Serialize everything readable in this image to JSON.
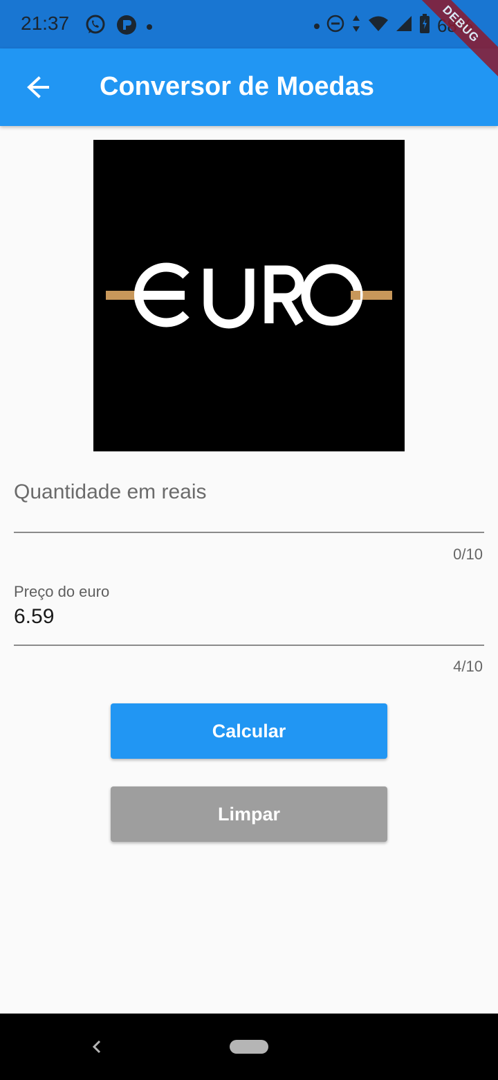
{
  "status_bar": {
    "time": "21:37",
    "battery_text": "68%",
    "left_icons": [
      "whatsapp-icon",
      "app-notification-icon",
      "dot"
    ],
    "right_icons": [
      "dot",
      "do-not-disturb-icon",
      "data-arrows-icon",
      "wifi-icon",
      "signal-icon",
      "battery-icon"
    ]
  },
  "debug_banner": "DEBUG",
  "app_bar": {
    "title": "Conversor de Moedas",
    "background": "#2196f3"
  },
  "logo": {
    "text": "€URO",
    "bar_color": "#c8975a"
  },
  "fields": {
    "amount": {
      "placeholder": "Quantidade em reais",
      "value": "",
      "counter": "0/10"
    },
    "price": {
      "label": "Preço do euro",
      "value": "6.59",
      "counter": "4/10"
    }
  },
  "buttons": {
    "calculate": "Calcular",
    "clear": "Limpar"
  },
  "colors": {
    "primary": "#2196f3",
    "status_bar": "#1976d2",
    "clear_button": "#9e9e9e"
  }
}
